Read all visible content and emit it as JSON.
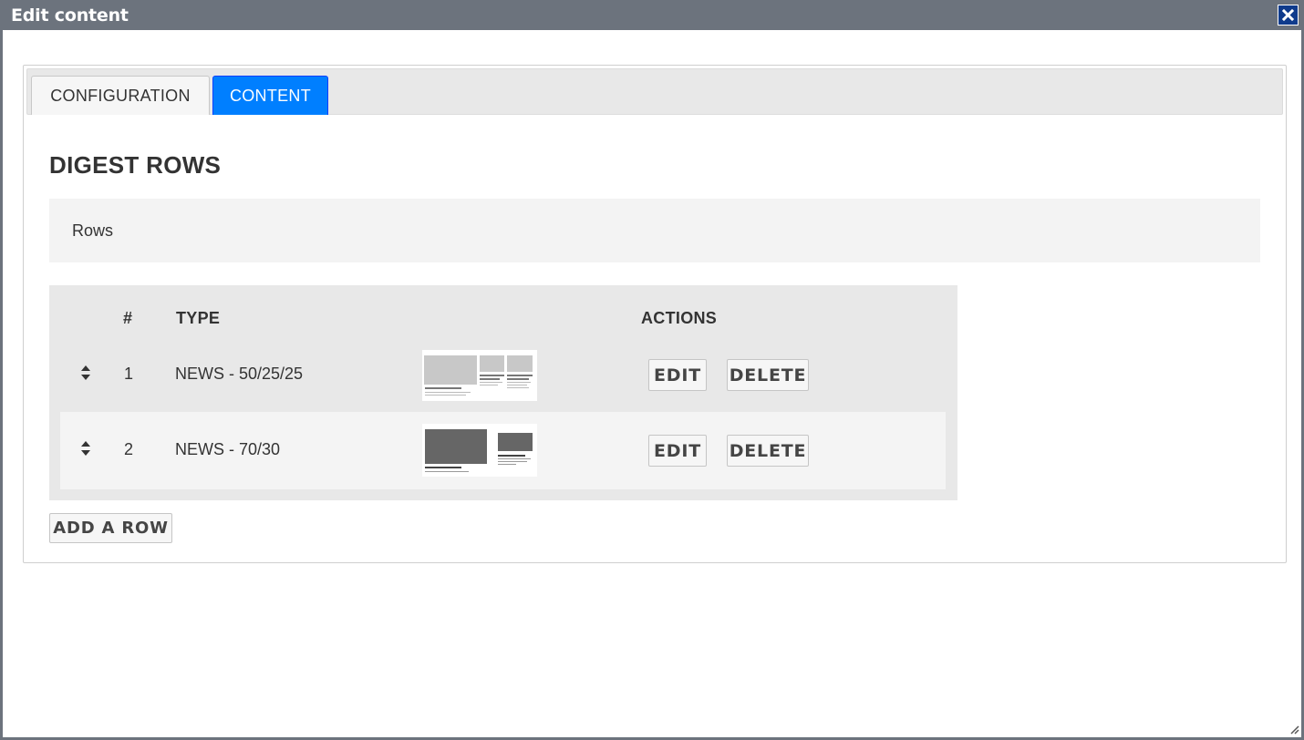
{
  "window": {
    "title": "Edit content",
    "close_icon": "close-icon"
  },
  "tabs": [
    {
      "label": "CONFIGURATION",
      "active": false
    },
    {
      "label": "CONTENT",
      "active": true
    }
  ],
  "section": {
    "title": "DIGEST ROWS",
    "rows_label": "Rows"
  },
  "table": {
    "headers": {
      "num": "#",
      "type": "TYPE",
      "actions": "ACTIONS"
    },
    "rows": [
      {
        "num": "1",
        "type": "NEWS - 50/25/25",
        "edit_label": "EDIT",
        "delete_label": "DELETE",
        "drag_icon": "sort-arrows-icon"
      },
      {
        "num": "2",
        "type": "NEWS - 70/30",
        "edit_label": "EDIT",
        "delete_label": "DELETE",
        "drag_icon": "sort-arrows-icon"
      }
    ]
  },
  "add_row_label": "ADD A ROW",
  "colors": {
    "titlebar": "#6c737d",
    "active_tab": "#007fff",
    "close_button": "#0f3b8c"
  }
}
